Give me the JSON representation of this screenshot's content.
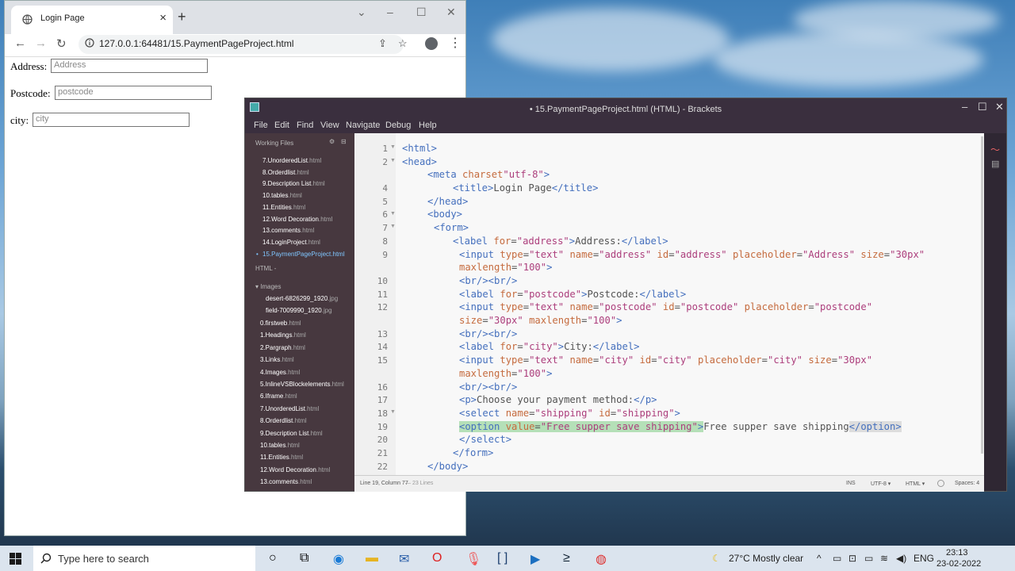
{
  "browser": {
    "tab_title": "Login Page",
    "url": "127.0.0.1:64481/15.PaymentPageProject.html",
    "form": {
      "address_label": "Address:",
      "address_placeholder": "Address",
      "postcode_label": "Postcode:",
      "postcode_placeholder": "postcode",
      "city_label": "city:",
      "city_placeholder": "city"
    }
  },
  "brackets": {
    "title": "• 15.PaymentPageProject.html (HTML) - Brackets",
    "menu": [
      "File",
      "Edit",
      "Find",
      "View",
      "Navigate",
      "Debug",
      "Help"
    ],
    "sidebar": {
      "working_files_header": "Working Files",
      "working_files": [
        {
          "name": "7.UnorderedList",
          "ext": ".html"
        },
        {
          "name": "8.Orderdlist",
          "ext": ".html"
        },
        {
          "name": "9.Description List",
          "ext": ".html"
        },
        {
          "name": "10.tables",
          "ext": ".html"
        },
        {
          "name": "11.Entities",
          "ext": ".html"
        },
        {
          "name": "12.Word Decoration",
          "ext": ".html"
        },
        {
          "name": "13.comments",
          "ext": ".html"
        },
        {
          "name": "14.LoginProject",
          "ext": ".html"
        },
        {
          "name": "15.PaymentPageProject",
          "ext": ".html"
        }
      ],
      "project_header": "HTML -",
      "images_header": "Images",
      "images": [
        {
          "name": "desert-6826299_1920",
          "ext": ".jpg"
        },
        {
          "name": "field-7009990_1920",
          "ext": ".jpg"
        }
      ],
      "project_files": [
        {
          "name": "0.firstweb",
          "ext": ".html"
        },
        {
          "name": "1.Headings",
          "ext": ".html"
        },
        {
          "name": "2.Pargraph",
          "ext": ".html"
        },
        {
          "name": "3.Links",
          "ext": ".html"
        },
        {
          "name": "4.Images",
          "ext": ".html"
        },
        {
          "name": "5.InlineVSBlockelements",
          "ext": ".html"
        },
        {
          "name": "6.Iframe",
          "ext": ".html"
        },
        {
          "name": "7.UnorderedList",
          "ext": ".html"
        },
        {
          "name": "8.Orderdlist",
          "ext": ".html"
        },
        {
          "name": "9.Description List",
          "ext": ".html"
        },
        {
          "name": "10.tables",
          "ext": ".html"
        },
        {
          "name": "11.Entities",
          "ext": ".html"
        },
        {
          "name": "12.Word Decoration",
          "ext": ".html"
        },
        {
          "name": "13.comments",
          "ext": ".html"
        }
      ]
    },
    "line_numbers": [
      "1",
      "2",
      "",
      "4",
      "5",
      "6",
      "7",
      "8",
      "9",
      "",
      "10",
      "11",
      "12",
      "",
      "13",
      "14",
      "15",
      "",
      "16",
      "17",
      "18",
      "19",
      "20",
      "21",
      "22"
    ],
    "status": {
      "position": "Line 19, Column 77",
      "lines": "— 23 Lines",
      "ins": "INS",
      "encoding": "UTF-8 ▾",
      "language": "HTML ▾",
      "spaces": "Spaces: 4"
    }
  },
  "taskbar": {
    "search_placeholder": "Type here to search",
    "weather": "27°C  Mostly clear",
    "language": "ENG",
    "time": "23:13",
    "date": "23-02-2022"
  }
}
